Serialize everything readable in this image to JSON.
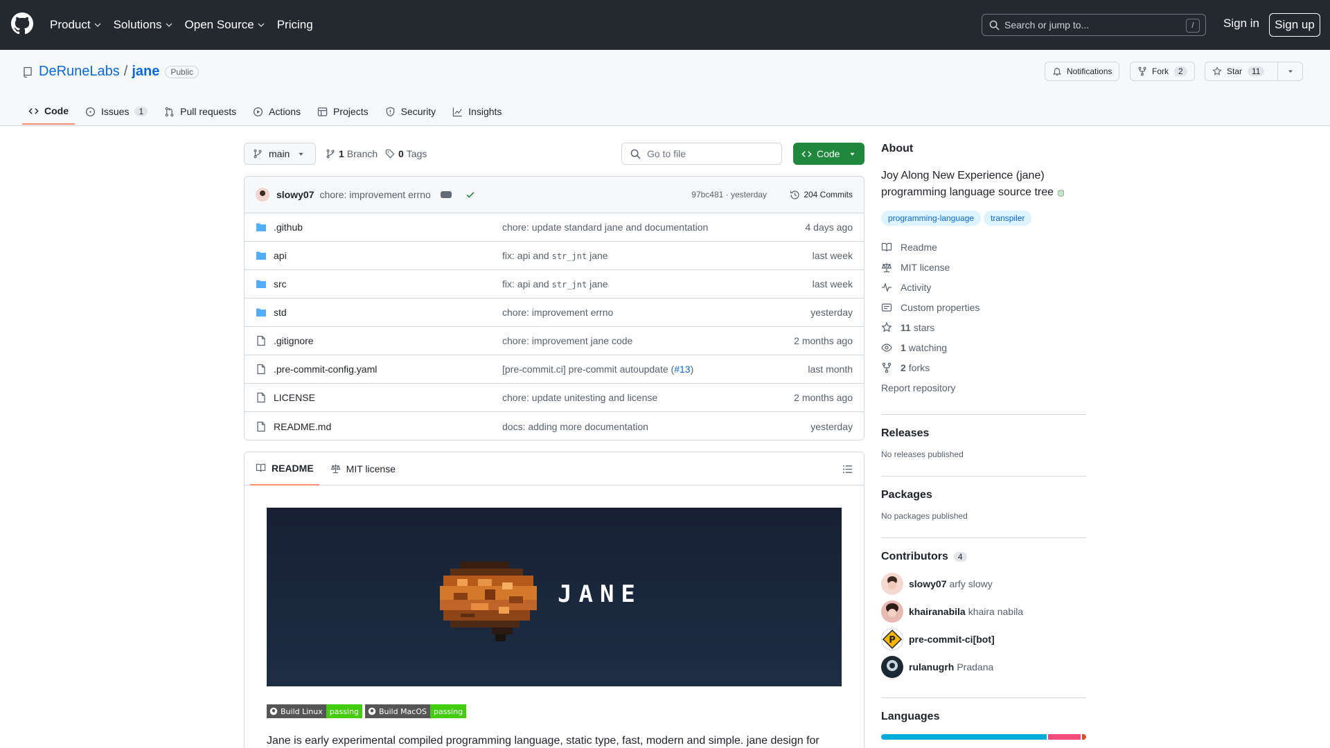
{
  "topnav": {
    "items": [
      "Product",
      "Solutions",
      "Open Source",
      "Pricing"
    ],
    "search_placeholder": "Search or jump to...",
    "search_shortcut": "/",
    "signin": "Sign in",
    "signup": "Sign up"
  },
  "repo": {
    "owner": "DeRuneLabs",
    "separator": "/",
    "name": "jane",
    "visibility": "Public",
    "notifications_label": "Notifications",
    "fork_label": "Fork",
    "fork_count": "2",
    "star_label": "Star",
    "star_count": "11"
  },
  "tabs": [
    {
      "label": "Code",
      "icon": "code-icon"
    },
    {
      "label": "Issues",
      "icon": "issue-icon",
      "count": "1"
    },
    {
      "label": "Pull requests",
      "icon": "pull-request-icon"
    },
    {
      "label": "Actions",
      "icon": "play-icon"
    },
    {
      "label": "Projects",
      "icon": "table-icon"
    },
    {
      "label": "Security",
      "icon": "shield-icon"
    },
    {
      "label": "Insights",
      "icon": "graph-icon"
    }
  ],
  "browser": {
    "branch": "main",
    "branch_count": "1",
    "branch_label": "Branch",
    "tag_count": "0",
    "tag_label": "Tags",
    "goto_placeholder": "Go to file",
    "code_button": "Code"
  },
  "last_commit": {
    "author": "slowy07",
    "message": "chore: improvement errno",
    "hash_time": "97bc481 · yesterday",
    "commits": "204 Commits"
  },
  "files": [
    {
      "name": ".github",
      "type": "folder",
      "msg": "chore: update standard jane and documentation",
      "date": "4 days ago"
    },
    {
      "name": "api",
      "type": "folder",
      "msg_pre": "fix: api and ",
      "msg_code": "str_jnt",
      "msg_post": " jane",
      "date": "last week"
    },
    {
      "name": "src",
      "type": "folder",
      "msg_pre": "fix: api and ",
      "msg_code": "str_jnt",
      "msg_post": " jane",
      "date": "last week"
    },
    {
      "name": "std",
      "type": "folder",
      "msg": "chore: improvement errno",
      "date": "yesterday"
    },
    {
      "name": ".gitignore",
      "type": "file",
      "msg": "chore: improvement jane code",
      "date": "2 months ago"
    },
    {
      "name": ".pre-commit-config.yaml",
      "type": "file",
      "msg_pre": "[pre-commit.ci] pre-commit autoupdate (",
      "msg_link": "#13",
      "msg_post": ")",
      "date": "last month"
    },
    {
      "name": "LICENSE",
      "type": "file",
      "msg": "chore: update unitesting and license",
      "date": "2 months ago"
    },
    {
      "name": "README.md",
      "type": "file",
      "msg": "docs: adding more documentation",
      "date": "yesterday"
    }
  ],
  "readme": {
    "tab_readme": "README",
    "tab_license": "MIT license",
    "banner_text": "JANE",
    "badges": [
      {
        "left": "Build Linux",
        "right": "passing"
      },
      {
        "left": "Build MacOS",
        "right": "passing"
      }
    ],
    "paragraph": "Jane is early experimental compiled programming language, static type, fast, modern and simple. jane design for"
  },
  "about": {
    "title": "About",
    "description": "Joy Along New Experience (jane) programming language source tree",
    "topics": [
      "programming-language",
      "transpiler"
    ],
    "links": [
      {
        "label": "Readme",
        "icon": "book-icon"
      },
      {
        "label": "MIT license",
        "icon": "law-icon"
      },
      {
        "label": "Activity",
        "icon": "pulse-icon"
      },
      {
        "label": "Custom properties",
        "icon": "note-icon"
      }
    ],
    "stars_count": "11",
    "stars_label": "stars",
    "watching_count": "1",
    "watching_label": "watching",
    "forks_count": "2",
    "forks_label": "forks",
    "report": "Report repository"
  },
  "releases": {
    "title": "Releases",
    "text": "No releases published"
  },
  "packages": {
    "title": "Packages",
    "text": "No packages published"
  },
  "contributors": {
    "title": "Contributors",
    "count": "4",
    "items": [
      {
        "login": "slowy07",
        "name": "arfy slowy"
      },
      {
        "login": "khairanabila",
        "name": "khaira nabila"
      },
      {
        "login": "pre-commit-ci[bot]",
        "name": ""
      },
      {
        "login": "rulanugrh",
        "name": "Pradana"
      }
    ]
  },
  "languages": {
    "title": "Languages",
    "shares": [
      {
        "fraction": 0.82,
        "color": "#00ADD8"
      },
      {
        "fraction": 0.16,
        "color": "#f34b7d"
      },
      {
        "fraction": 0.02,
        "color": "#e34c26"
      }
    ]
  },
  "colors": {
    "accent": "#0969da",
    "header_bg": "#24292f",
    "primary_button": "#1f883d",
    "active_tab": "#fd8c73"
  }
}
